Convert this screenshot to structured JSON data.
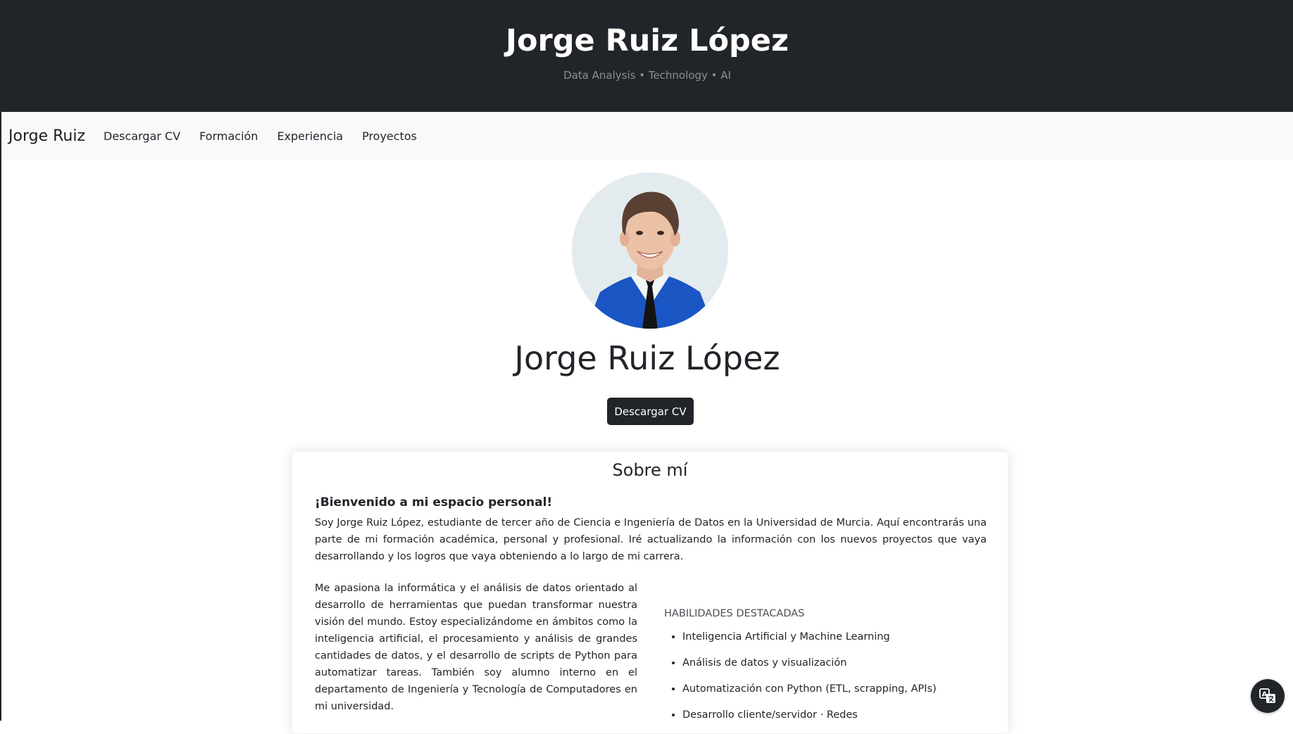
{
  "header": {
    "title": "Jorge Ruiz López",
    "subtitle": "Data Analysis • Technology • AI"
  },
  "navbar": {
    "brand": "Jorge Ruiz",
    "links": [
      "Descargar CV",
      "Formación",
      "Experiencia",
      "Proyectos"
    ]
  },
  "profile": {
    "name": "Jorge Ruiz López",
    "cv_button": "Descargar CV"
  },
  "about": {
    "title": "Sobre mí",
    "welcome": "¡Bienvenido a mi espacio personal!",
    "intro": "Soy Jorge Ruiz López, estudiante de tercer año de Ciencia e Ingeniería de Datos en la Universidad de Murcia. Aquí encontrarás una parte de mi formación académica, personal y profesional. Iré actualizando la información con los nuevos proyectos que vaya desarrollando y los logros que vaya obteniendo a lo largo de mi carrera.",
    "passion": "Me apasiona la informática y el análisis de datos orientado al desarrollo de herramientas que puedan transformar nuestra visión del mundo. Estoy especializándome en ámbitos como la inteligencia artificial, el procesamiento y análisis de grandes cantidades de datos, y el desarrollo de scripts de Python para automatizar tareas. También soy alumno interno en el departamento de Ingeniería y Tecnología de Computadores en mi universidad.",
    "skills_heading": "HABILIDADES DESTACADAS",
    "skills": [
      "Inteligencia Artificial y Machine Learning",
      "Análisis de datos y visualización",
      "Automatización con Python (ETL, scrapping, APIs)",
      "Desarrollo cliente/servidor · Redes"
    ]
  },
  "colors": {
    "header_bg": "#212529",
    "navbar_bg": "#f8f9fa",
    "button_bg": "#212529",
    "shirt_blue": "#1a56c4"
  },
  "icons": {
    "translate": "translate-icon"
  }
}
